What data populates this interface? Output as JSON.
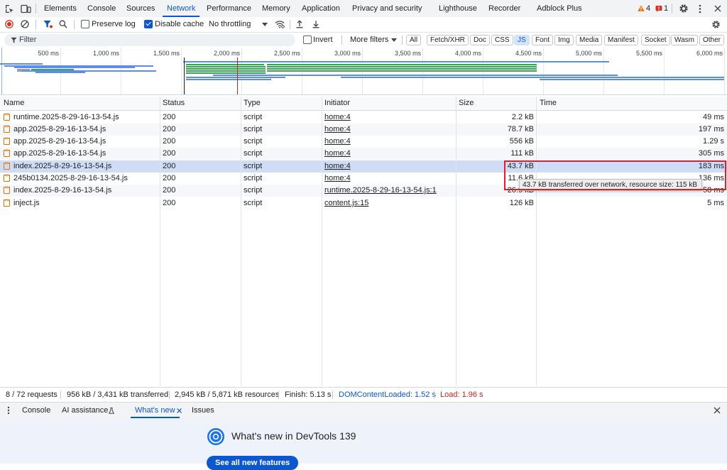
{
  "tabs": {
    "items": [
      "Elements",
      "Console",
      "Sources",
      "Network",
      "Performance",
      "Memory",
      "Application",
      "Privacy and security",
      "Lighthouse",
      "Recorder",
      "Adblock Plus"
    ],
    "active": "Network",
    "warnings_count": "4",
    "errors_count": "1"
  },
  "toolbar": {
    "preserve_log": "Preserve log",
    "disable_cache": "Disable cache",
    "throttling": "No throttling"
  },
  "filterbar": {
    "placeholder": "Filter",
    "invert": "Invert",
    "more_filters": "More filters",
    "types": [
      "All",
      "Fetch/XHR",
      "Doc",
      "CSS",
      "JS",
      "Font",
      "Img",
      "Media",
      "Manifest",
      "Socket",
      "Wasm",
      "Other"
    ],
    "active_type": "JS"
  },
  "overview": {
    "ticks": [
      "500 ms",
      "1,000 ms",
      "1,500 ms",
      "2,000 ms",
      "2,500 ms",
      "3,000 ms",
      "3,500 ms",
      "4,000 ms",
      "4,500 ms",
      "5,000 ms",
      "5,500 ms",
      "6,000 ms"
    ]
  },
  "table": {
    "columns": [
      "Name",
      "Status",
      "Type",
      "Initiator",
      "Size",
      "Time"
    ],
    "rows": [
      {
        "name": "runtime.2025-8-29-16-13-54.js",
        "status": "200",
        "type": "script",
        "initiator": "home:4",
        "size": "2.2 kB",
        "time": "49 ms"
      },
      {
        "name": "app.2025-8-29-16-13-54.js",
        "status": "200",
        "type": "script",
        "initiator": "home:4",
        "size": "78.7 kB",
        "time": "197 ms"
      },
      {
        "name": "app.2025-8-29-16-13-54.js",
        "status": "200",
        "type": "script",
        "initiator": "home:4",
        "size": "556 kB",
        "time": "1.29 s"
      },
      {
        "name": "app.2025-8-29-16-13-54.js",
        "status": "200",
        "type": "script",
        "initiator": "home:4",
        "size": "111 kB",
        "time": "305 ms"
      },
      {
        "name": "index.2025-8-29-16-13-54.js",
        "status": "200",
        "type": "script",
        "initiator": "home:4",
        "size": "43.7 kB",
        "time": "183 ms"
      },
      {
        "name": "245b0134.2025-8-29-16-13-54.js",
        "status": "200",
        "type": "script",
        "initiator": "home:4",
        "size": "11.6 kB",
        "time": "136 ms"
      },
      {
        "name": "index.2025-8-29-16-13-54.js",
        "status": "200",
        "type": "script",
        "initiator": "runtime.2025-8-29-16-13-54.js:1",
        "size": "26.9 kB",
        "time": "58 ms"
      },
      {
        "name": "inject.js",
        "status": "200",
        "type": "script",
        "initiator": "content.js:15",
        "size": "126 kB",
        "time": "5 ms"
      }
    ]
  },
  "tooltip": "43.7 kB transferred over network, resource size: 115 kB",
  "status": {
    "requests": "8 / 72 requests",
    "transferred": "956 kB / 3,431 kB transferred",
    "resources": "2,945 kB / 5,871 kB resources",
    "finish": "Finish: 5.13 s",
    "dcl": "DOMContentLoaded: 1.52 s",
    "load": "Load: 1.96 s"
  },
  "drawer": {
    "tabs": [
      "Console",
      "AI assistance",
      "What's new",
      "Issues"
    ],
    "active": "What's new",
    "heading": "What's new in DevTools 139",
    "button": "See all new features"
  },
  "colors": {
    "accent": "#0b57d0",
    "error": "#c5221f",
    "highlight": "#e11d2a"
  }
}
